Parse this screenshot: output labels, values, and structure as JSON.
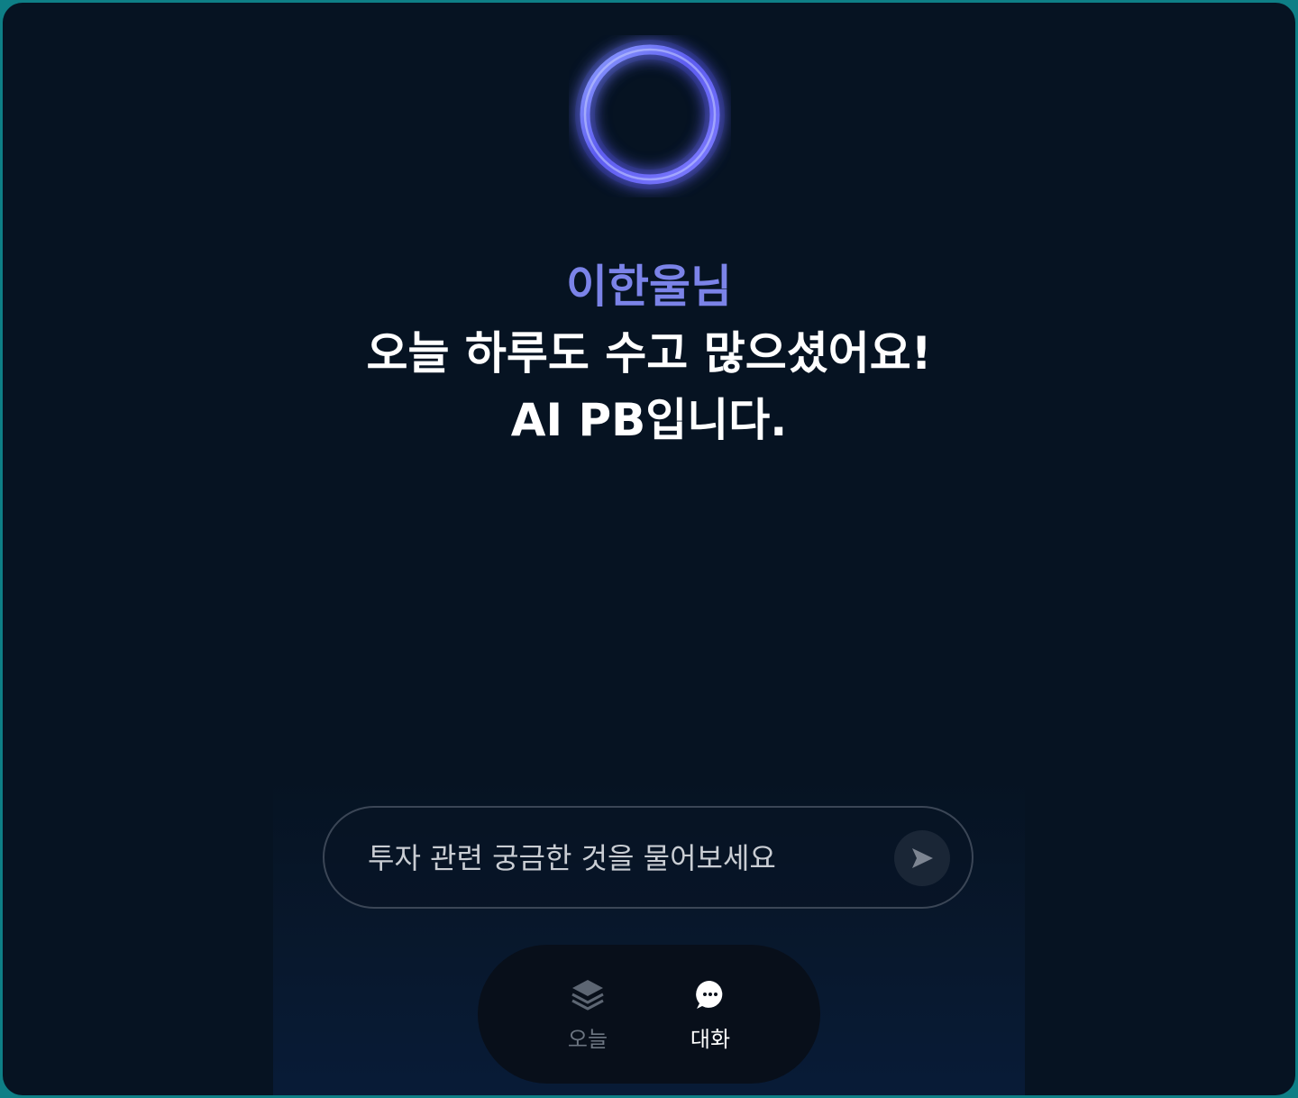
{
  "greeting": {
    "name": "이한울님",
    "line1": "오늘 하루도 수고 많으셨어요!",
    "line2": "AI PB입니다."
  },
  "chat": {
    "placeholder": "투자 관련 궁금한 것을 물어보세요",
    "send_icon": "send-arrow-icon"
  },
  "tabs": [
    {
      "label": "오늘",
      "icon": "layers-icon",
      "active": false
    },
    {
      "label": "대화",
      "icon": "chat-bubble-icon",
      "active": true
    }
  ],
  "colors": {
    "background": "#061322",
    "frame_border": "#0e7f86",
    "accent_name": "#7b83e8",
    "orb": "#6f73ff",
    "tab_inactive": "#6c7581",
    "tab_active": "#ffffff"
  }
}
